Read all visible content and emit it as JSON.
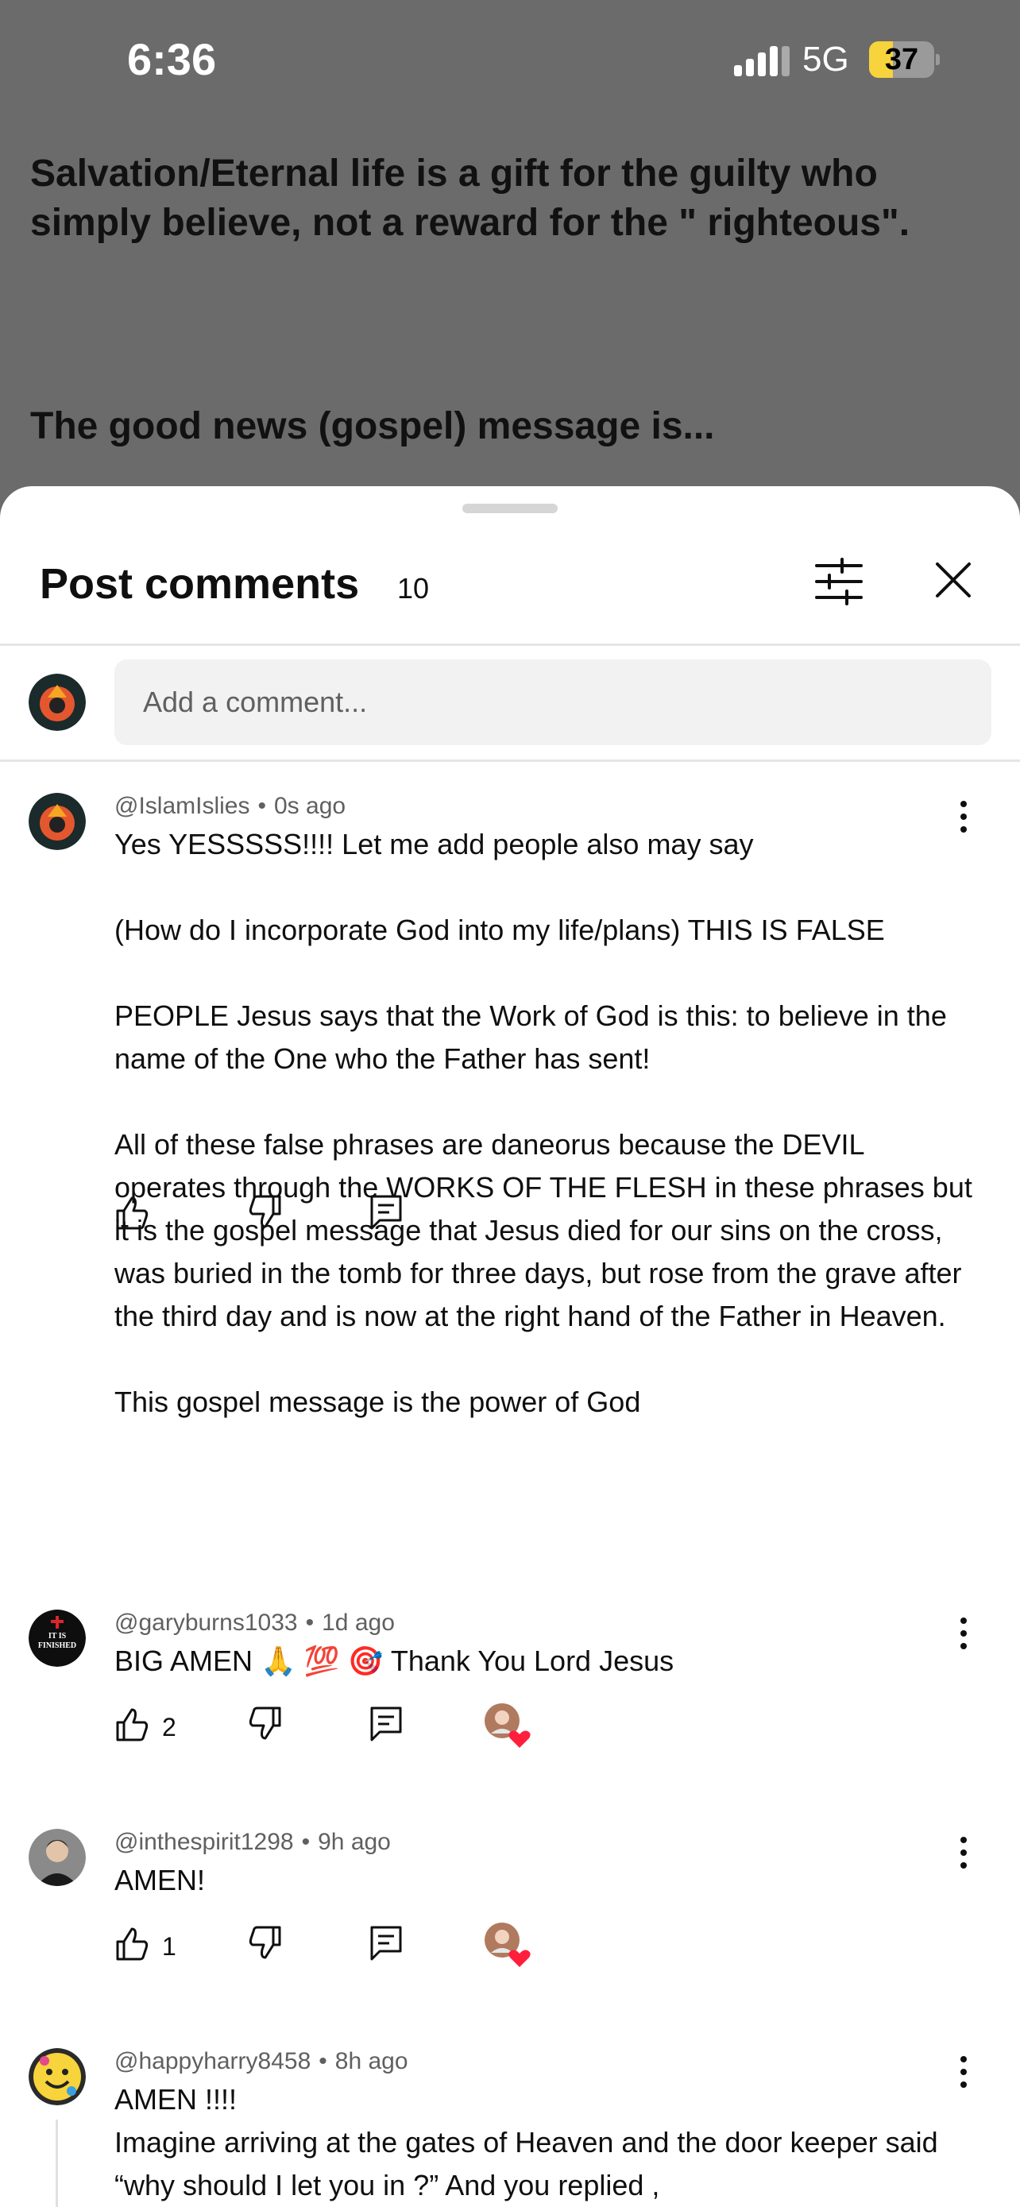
{
  "status_bar": {
    "time": "6:36",
    "network": "5G",
    "battery": "37",
    "battery_level": 0.37
  },
  "background_post": {
    "line1": "Salvation/Eternal life is a gift for the guilty who simply believe, not a reward for the \" righteous\".",
    "line2": "The good news (gospel) message is..."
  },
  "sheet": {
    "title": "Post comments",
    "count": "10",
    "add_comment_placeholder": "Add a comment..."
  },
  "comments": [
    {
      "author": "@IslamIslies",
      "time": "0s ago",
      "text": "Yes YESSSSS!!!! Let me add people also may say\n\n(How do I incorporate God into my life/plans) THIS IS FALSE\n\nPEOPLE Jesus says that the Work of God is this: to believe in the name of the One who the Father has sent!\n\nAll of these false phrases are daneorus because the DEVIL operates through the WORKS OF THE FLESH in these phrases but it is the gospel message that Jesus died for our sins on the cross, was buried in the tomb for three days, but rose from the grave after the third day and is now at the right hand of the Father in Heaven.\n\nThis gospel message is the power of God",
      "likes": ""
    },
    {
      "author": "@garyburns1033",
      "time": "1d ago",
      "text": "BIG AMEN 🙏 💯 🎯 Thank You Lord Jesus",
      "likes": "2",
      "avatar_label": "IT IS FINISHED"
    },
    {
      "author": "@inthespirit1298",
      "time": "9h ago",
      "text": "AMEN!",
      "likes": "1"
    },
    {
      "author": "@happyharry8458",
      "time": "8h ago",
      "text": "AMEN !!!!\nImagine arriving at the gates of Heaven and the door keeper said “why should I let you in ?” And you replied ,",
      "likes": ""
    }
  ],
  "icons": {
    "like": "thumbs-up-icon",
    "dislike": "thumbs-down-icon",
    "reply": "reply-icon",
    "more": "more-vert-icon",
    "filter": "filter-sliders-icon",
    "close": "close-icon",
    "heart": "creator-heart-icon"
  },
  "colors": {
    "accent_heart": "#ff1e3c",
    "battery": "#f7d33c"
  }
}
